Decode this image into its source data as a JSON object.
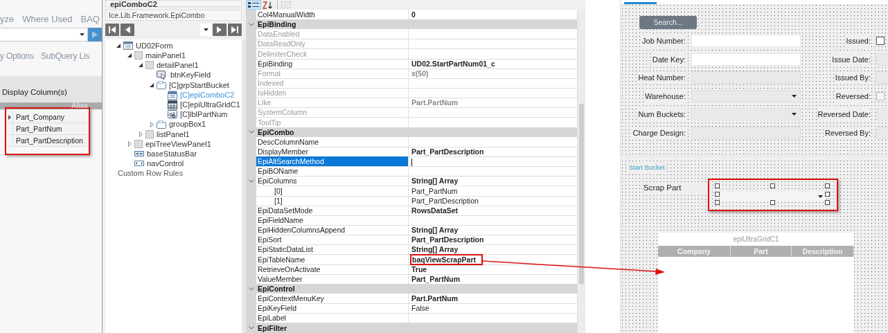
{
  "left_panel": {
    "tabs": [
      "yze",
      "Where Used",
      "BAQ"
    ],
    "subtabs": [
      "y Options",
      "SubQuery Lis"
    ],
    "section_title": "Display Column(s)",
    "grid": {
      "columns": [
        "Alias"
      ],
      "highlighted": true,
      "rows": [
        {
          "cells": [
            "Part_Company"
          ],
          "current": true
        },
        {
          "cells": [
            "Part_PartNum"
          ],
          "current": false
        },
        {
          "cells": [
            "Part_PartDescription"
          ],
          "current": false
        }
      ]
    }
  },
  "properties_dialog": {
    "title": "epiComboC2",
    "type_name": "Ice.Lib.Framework.EpiCombo",
    "tree": [
      {
        "label": "UD02Form",
        "kind": "form",
        "expanded": true,
        "selected": false,
        "children": [
          {
            "label": "mainPanel1",
            "kind": "panel",
            "expanded": true,
            "selected": false,
            "children": [
              {
                "label": "detailPanel1",
                "kind": "panel",
                "expanded": true,
                "selected": false,
                "children": [
                  {
                    "label": "btnKeyField",
                    "kind": "button",
                    "selected": false
                  },
                  {
                    "label": "[C]grpStartBucket",
                    "kind": "group",
                    "expanded": true,
                    "selected": false,
                    "children": [
                      {
                        "label": "[C]epiComboC2",
                        "kind": "combo",
                        "selected": true
                      },
                      {
                        "label": "[C]epiUltraGridC1",
                        "kind": "grid",
                        "selected": false
                      },
                      {
                        "label": "[C]lblPartNum",
                        "kind": "label",
                        "selected": false
                      }
                    ]
                  },
                  {
                    "label": "groupBox1",
                    "kind": "group",
                    "expanded": false,
                    "selected": false
                  }
                ]
              },
              {
                "label": "listPanel1",
                "kind": "panel",
                "expanded": false,
                "selected": false
              }
            ]
          },
          {
            "label": "epiTreeViewPanel1",
            "kind": "panel",
            "expanded": false,
            "selected": false
          },
          {
            "label": "baseStatusBar",
            "kind": "statusbar",
            "selected": false
          },
          {
            "label": "navControl",
            "kind": "navcontrol",
            "selected": false
          }
        ]
      }
    ],
    "extra_item": "Custom Row Rules"
  },
  "property_grid": {
    "toolbar": [
      {
        "kind": "categorized",
        "selected": true,
        "disabled": false
      },
      {
        "kind": "alphabetical",
        "selected": false,
        "disabled": false
      },
      {
        "kind": "pages",
        "selected": false,
        "disabled": true
      }
    ],
    "rows": [
      {
        "kind": "property",
        "name": "Col4ManualWidth",
        "value": "0",
        "modified": true,
        "disabled": false,
        "selected": false
      },
      {
        "kind": "category",
        "name": "EpiBinding",
        "expanded": true,
        "children": [
          {
            "kind": "property",
            "name": "DataEnabled",
            "disabled": true,
            "selected": false
          },
          {
            "kind": "property",
            "name": "DataReadOnly",
            "disabled": true,
            "selected": false
          },
          {
            "kind": "property",
            "name": "DelimiterCheck",
            "disabled": true,
            "selected": false
          },
          {
            "kind": "property",
            "name": "EpiBinding",
            "value": "UD02.StartPartNum01_c",
            "modified": true,
            "disabled": false,
            "selected": false
          },
          {
            "kind": "property",
            "name": "Format",
            "value": "x(50)",
            "modified": true,
            "disabled": true,
            "selected": false
          },
          {
            "kind": "property",
            "name": "Indexed",
            "disabled": true,
            "selected": false
          },
          {
            "kind": "property",
            "name": "IsHidden",
            "disabled": true,
            "selected": false
          },
          {
            "kind": "property",
            "name": "Like",
            "value": "Part.PartNum",
            "modified": true,
            "disabled": true,
            "selected": false
          },
          {
            "kind": "property",
            "name": "SystemColumn",
            "disabled": true,
            "selected": false
          },
          {
            "kind": "property",
            "name": "ToolTip",
            "disabled": true,
            "selected": false
          }
        ]
      },
      {
        "kind": "category",
        "name": "EpiCombo",
        "expanded": true,
        "children": [
          {
            "kind": "property",
            "name": "DescColumnName",
            "disabled": false,
            "selected": false
          },
          {
            "kind": "property",
            "name": "DisplayMember",
            "value": "Part_PartDescription",
            "modified": true,
            "disabled": false,
            "selected": false
          },
          {
            "kind": "property",
            "name": "EpiAltSearchMethod",
            "disabled": false,
            "selected": true,
            "editing": true
          },
          {
            "kind": "property",
            "name": "EpiBOName",
            "disabled": false,
            "selected": false
          },
          {
            "kind": "property",
            "name": "EpiColumns",
            "value": "String[] Array",
            "modified": true,
            "disabled": false,
            "selected": false,
            "expanded": true,
            "children": [
              {
                "kind": "property",
                "name": "[0]",
                "value": "Part_PartNum",
                "modified": false,
                "disabled": false,
                "selected": false
              },
              {
                "kind": "property",
                "name": "[1]",
                "value": "Part_PartDescription",
                "modified": false,
                "disabled": false,
                "selected": false
              }
            ]
          },
          {
            "kind": "property",
            "name": "EpiDataSetMode",
            "value": "RowsDataSet",
            "modified": true,
            "disabled": false,
            "selected": false
          },
          {
            "kind": "property",
            "name": "EpiFieldName",
            "disabled": false,
            "selected": false
          },
          {
            "kind": "property",
            "name": "EpiHiddenColumnsAppend",
            "value": "String[] Array",
            "modified": true,
            "disabled": false,
            "selected": false
          },
          {
            "kind": "property",
            "name": "EpiSort",
            "value": "Part_PartDescription",
            "modified": true,
            "disabled": false,
            "selected": false
          },
          {
            "kind": "property",
            "name": "EpiStaticDataList",
            "value": "String[] Array",
            "modified": true,
            "disabled": false,
            "selected": false
          },
          {
            "kind": "property",
            "name": "EpiTableName",
            "value": "baqViewScrapPart",
            "modified": true,
            "disabled": false,
            "selected": false,
            "highlighted": true
          },
          {
            "kind": "property",
            "name": "RetrieveOnActivate",
            "value": "True",
            "modified": true,
            "disabled": false,
            "selected": false
          },
          {
            "kind": "property",
            "name": "ValueMember",
            "value": "Part_PartNum",
            "modified": true,
            "disabled": false,
            "selected": false
          }
        ]
      },
      {
        "kind": "category",
        "name": "EpiControl",
        "expanded": true,
        "children": [
          {
            "kind": "property",
            "name": "EpiContextMenuKey",
            "value": "Part.PartNum",
            "modified": true,
            "disabled": false,
            "selected": false
          },
          {
            "kind": "property",
            "name": "EpiKeyField",
            "value": "False",
            "modified": false,
            "disabled": false,
            "selected": false
          },
          {
            "kind": "property",
            "name": "EpiLabel",
            "disabled": false,
            "selected": false
          }
        ]
      },
      {
        "kind": "category",
        "name": "EpiFilter",
        "expanded": true,
        "children": []
      }
    ]
  },
  "form": {
    "search_button": "Search...",
    "rows": [
      {
        "left": {
          "label": "Job Number:",
          "kind": "text",
          "disabled": false
        },
        "right": {
          "label": "Issued:",
          "kind": "checkbox",
          "disabled": false,
          "checked": false
        }
      },
      {
        "left": {
          "label": "Date Key:",
          "kind": "text",
          "disabled": false
        },
        "right": {
          "label": "Issue Date:",
          "kind": "text",
          "disabled": true
        }
      },
      {
        "left": {
          "label": "Heat Number:",
          "kind": "text",
          "disabled": true
        },
        "right": {
          "label": "Issued By:",
          "kind": "text",
          "disabled": true
        }
      },
      {
        "left": {
          "label": "Warehouse:",
          "kind": "combo",
          "disabled": true
        },
        "right": {
          "label": "Reversed:",
          "kind": "checkbox",
          "disabled": true,
          "checked": false
        }
      },
      {
        "left": {
          "label": "Num Buckets:",
          "kind": "combo",
          "disabled": true
        },
        "right": {
          "label": "Reversed Date:",
          "kind": "text",
          "disabled": true
        }
      },
      {
        "left": {
          "label": "Charge Design:",
          "kind": "text",
          "disabled": true
        },
        "right": {
          "label": "Reversed By:",
          "kind": "text",
          "disabled": true
        }
      }
    ],
    "group": {
      "title": "Start Bucket",
      "scrap": {
        "label": "Scrap Part",
        "kind": "combo",
        "selected": true,
        "highlighted": true
      },
      "grid": {
        "title": "epiUltraGridC1",
        "columns": [
          "Company",
          "Part",
          "Description"
        ]
      }
    }
  }
}
